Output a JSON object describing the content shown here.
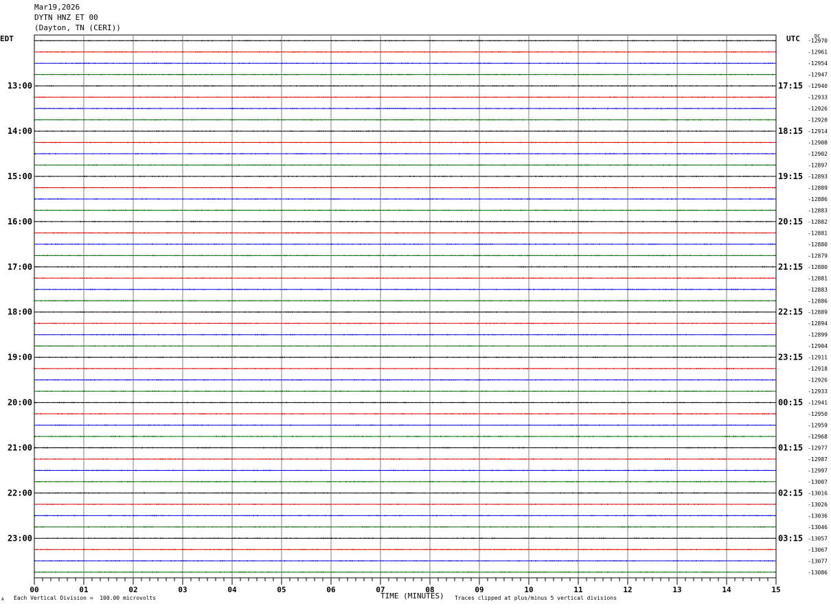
{
  "header": {
    "date": "Mar19,2026",
    "station": "DYTN HNZ ET 00",
    "location": "(Dayton, TN (CERI))"
  },
  "left_axis_title": "EDT",
  "right_axis_title": "UTC",
  "dc_label": "DC",
  "footer": {
    "scale_note": "Each Vertical Division =  100.00 microvolts",
    "clip_note": "Traces clipped at plus/minus 5 vertical divisions",
    "logo_mark": "A"
  },
  "colors": {
    "black": "#000000",
    "red": "#e00000",
    "blue": "#0000e0",
    "green": "#006400",
    "grid": "#808080"
  },
  "chart_data": {
    "type": "line",
    "title": "DYTN HNZ ET 00",
    "xlabel": "TIME (MINUTES)",
    "ylabel": "",
    "xlim": [
      0,
      15
    ],
    "x_ticks": [
      "00",
      "01",
      "02",
      "03",
      "04",
      "05",
      "06",
      "07",
      "08",
      "09",
      "10",
      "11",
      "12",
      "13",
      "14",
      "15"
    ],
    "left_time_labels": [
      "13:00",
      "14:00",
      "15:00",
      "16:00",
      "17:00",
      "18:00",
      "19:00",
      "20:00",
      "21:00",
      "22:00",
      "23:00"
    ],
    "right_time_labels": [
      "17:15",
      "18:15",
      "19:15",
      "20:15",
      "21:15",
      "22:15",
      "23:15",
      "00:15",
      "01:15",
      "02:15",
      "03:15"
    ],
    "trace_colors": [
      "black",
      "red",
      "blue",
      "green"
    ],
    "dc_offsets": [
      -12970,
      -12961,
      -12954,
      -12947,
      -12940,
      -12933,
      -12926,
      -12920,
      -12914,
      -12908,
      -12902,
      -12897,
      -12893,
      -12889,
      -12886,
      -12883,
      -12882,
      -12881,
      -12880,
      -12879,
      -12880,
      -12881,
      -12883,
      -12886,
      -12889,
      -12894,
      -12899,
      -12904,
      -12911,
      -12918,
      -12926,
      -12933,
      -12941,
      -12950,
      -12959,
      -12968,
      -12977,
      -12987,
      -12997,
      -13007,
      -13016,
      -13026,
      -13036,
      -13046,
      -13057,
      -13067,
      -13077,
      -13086
    ]
  }
}
